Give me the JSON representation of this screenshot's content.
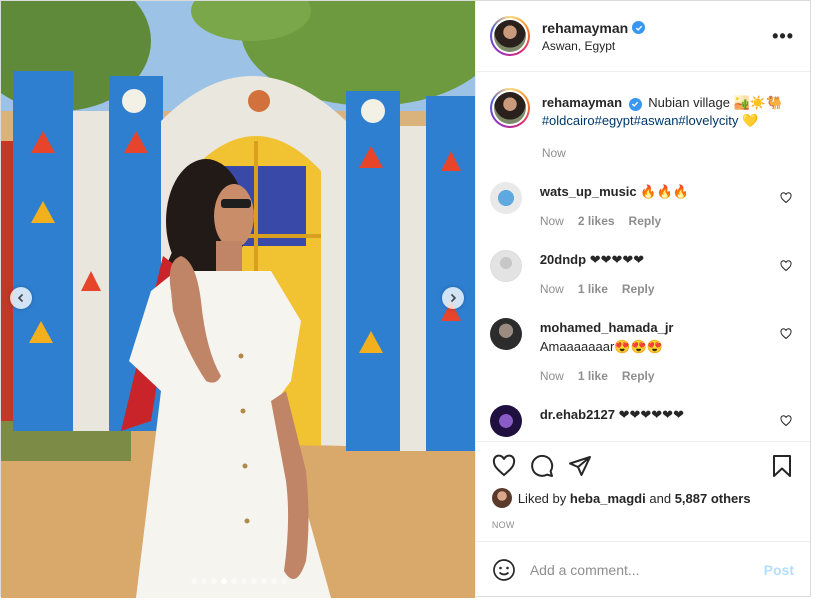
{
  "post": {
    "username": "rehamayman",
    "location": "Aswan, Egypt",
    "more_label": "•••"
  },
  "caption": {
    "username": "rehamayman",
    "text": "Nubian village 🏜️☀️🐫",
    "tags": "#oldcairo#egypt#aswan#lovelycity",
    "trail": "💛",
    "time": "Now"
  },
  "comments": [
    {
      "username": "wats_up_music",
      "text": "🔥🔥🔥",
      "time": "Now",
      "likes": "2 likes",
      "reply": "Reply"
    },
    {
      "username": "20dndp",
      "text": "❤❤❤❤❤",
      "time": "Now",
      "likes": "1 like",
      "reply": "Reply"
    },
    {
      "username": "mohamed_hamada_jr",
      "text": "Amaaaaaaar😍😍😍",
      "time": "Now",
      "likes": "1 like",
      "reply": "Reply"
    },
    {
      "username": "dr.ehab2127",
      "text": "❤❤❤❤❤❤",
      "time": "",
      "likes": "",
      "reply": ""
    }
  ],
  "likes": {
    "prefix": "Liked by",
    "user": "heba_magdi",
    "joiner": "and",
    "others": "5,887 others"
  },
  "timestamp": "NOW",
  "add_comment": {
    "placeholder": "Add a comment...",
    "post_label": "Post"
  },
  "colors": {
    "accent": "#3897f0",
    "link": "#00376b",
    "muted": "#8e8e8e",
    "post_disabled": "#b2dffc"
  },
  "carousel": {
    "dot_count": 10,
    "active_index": 3
  }
}
